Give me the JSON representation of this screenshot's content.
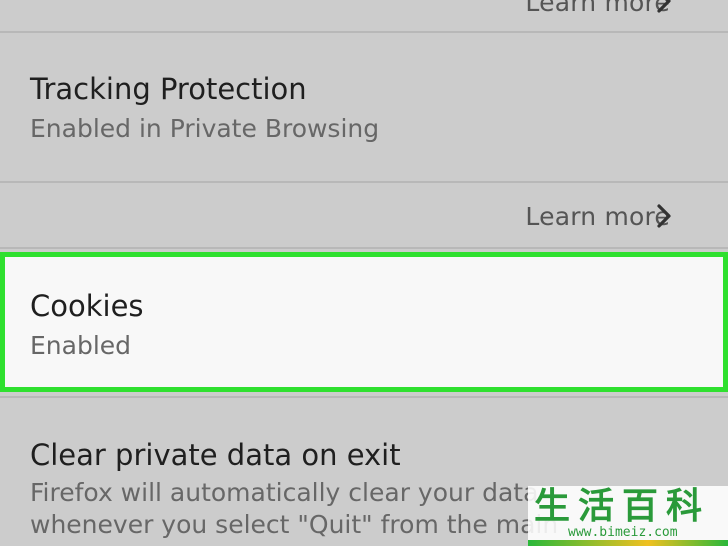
{
  "colors": {
    "background": "#cccccc",
    "highlight_border": "#2fe02f",
    "highlight_background": "#f8f8f8",
    "watermark": "#2a9a3a"
  },
  "learn_more_top": {
    "label": "Learn more",
    "icon": "chevron-right-icon"
  },
  "tracking_protection": {
    "title": "Tracking Protection",
    "summary": "Enabled in Private Browsing"
  },
  "learn_more": {
    "label": "Learn more",
    "icon": "chevron-right-icon"
  },
  "cookies": {
    "title": "Cookies",
    "summary": "Enabled"
  },
  "clear_private_data": {
    "title": "Clear private data on exit",
    "summary_line1": "Firefox will automatically clear your data",
    "summary_line2": "whenever you select \"Quit\" from the main"
  },
  "watermark": {
    "chars": "生活百科",
    "url": "www.bimeiz.com"
  }
}
